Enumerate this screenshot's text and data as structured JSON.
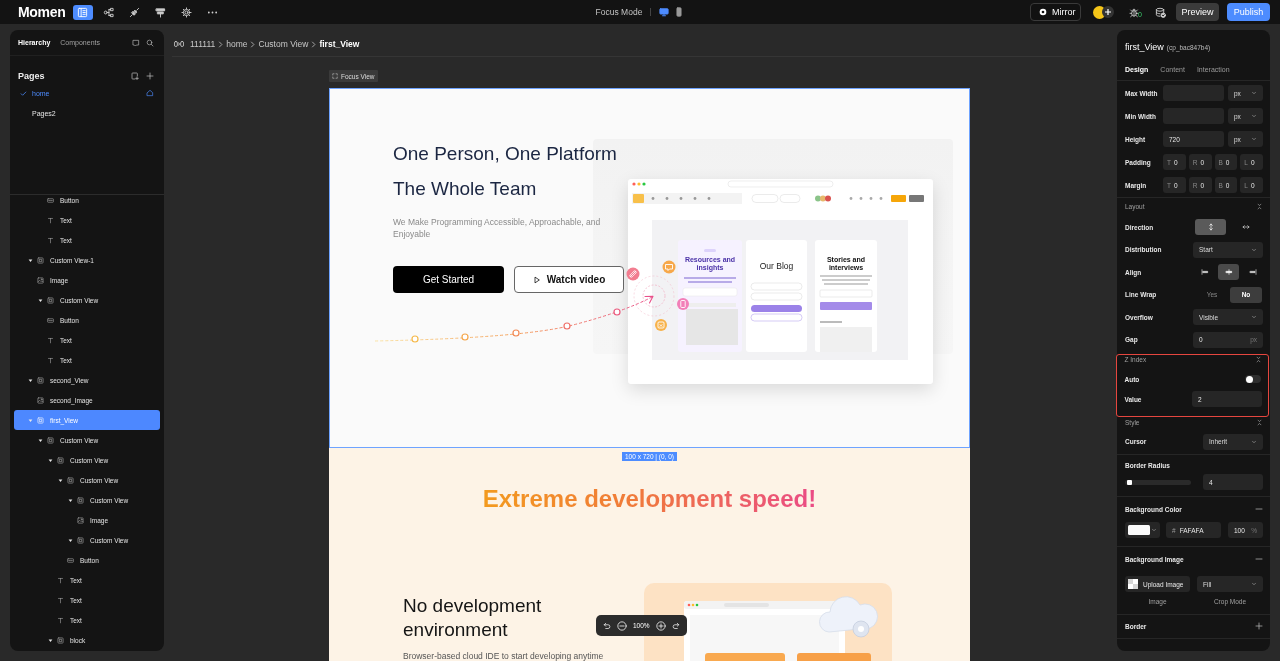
{
  "top_bar": {
    "logo": "Momen",
    "tools": [
      {
        "kind": "pages",
        "selected": true
      },
      {
        "kind": "flow",
        "selected": false
      },
      {
        "kind": "plugin",
        "selected": false
      },
      {
        "kind": "data",
        "selected": false
      },
      {
        "kind": "settings",
        "selected": false
      },
      {
        "kind": "more",
        "selected": false
      }
    ],
    "mode": "Focus Mode",
    "devices": [
      {
        "kind": "desktop",
        "selected": true
      },
      {
        "kind": "mobile",
        "selected": false
      }
    ],
    "mirror": "Mirror",
    "issues": "0",
    "preview": "Preview",
    "publish": "Publish"
  },
  "left_panel": {
    "tabs": [
      {
        "label": "Hierarchy",
        "selected": true
      },
      {
        "label": "Components",
        "selected": false
      }
    ],
    "pages": {
      "title": "Pages",
      "items": [
        {
          "label": "home",
          "selected": true,
          "home": true
        },
        {
          "label": "Pages2",
          "selected": false,
          "home": false
        }
      ]
    },
    "tree": [
      {
        "children": [
          {
            "children": [
              {
                "label": "Button",
                "kind": "button",
                "selected": false
              },
              {
                "label": "Text",
                "kind": "text",
                "selected": false
              },
              {
                "label": "Text",
                "kind": "text",
                "selected": false
              }
            ]
          }
        ]
      },
      {
        "label": "Custom View-1",
        "kind": "view",
        "expanded": true,
        "selected": false,
        "children": [
          {
            "label": "Image",
            "kind": "image",
            "selected": false
          },
          {
            "label": "Custom View",
            "kind": "view",
            "expanded": true,
            "selected": false,
            "children": [
              {
                "label": "Button",
                "kind": "button",
                "selected": false
              },
              {
                "label": "Text",
                "kind": "text",
                "selected": false
              },
              {
                "label": "Text",
                "kind": "text",
                "selected": false
              }
            ]
          }
        ]
      },
      {
        "label": "second_View",
        "kind": "view",
        "expanded": true,
        "selected": false,
        "children": [
          {
            "label": "second_Image",
            "kind": "image",
            "selected": false
          }
        ]
      },
      {
        "label": "first_View",
        "kind": "view",
        "expanded": true,
        "selected": true,
        "children": [
          {
            "label": "Custom View",
            "kind": "view",
            "expanded": true,
            "selected": false,
            "children": [
              {
                "label": "Custom View",
                "kind": "view",
                "expanded": true,
                "selected": false,
                "children": [
                  {
                    "label": "Custom View",
                    "kind": "view",
                    "expanded": true,
                    "selected": false,
                    "children": [
                      {
                        "label": "Custom View",
                        "kind": "view",
                        "expanded": true,
                        "selected": false,
                        "children": [
                          {
                            "label": "Image",
                            "kind": "image",
                            "selected": false
                          }
                        ]
                      },
                      {
                        "label": "Custom View",
                        "kind": "view",
                        "expanded": true,
                        "selected": false
                      },
                      {
                        "label": "Button",
                        "kind": "button",
                        "selected": false
                      }
                    ]
                  },
                  {
                    "label": "Text",
                    "kind": "text",
                    "selected": false
                  },
                  {
                    "label": "Text",
                    "kind": "text",
                    "selected": false
                  },
                  {
                    "label": "Text",
                    "kind": "text",
                    "selected": false
                  }
                ]
              },
              {
                "label": "block",
                "kind": "view",
                "expanded": true,
                "selected": false
              }
            ]
          }
        ]
      }
    ]
  },
  "breadcrumb": [
    "111111",
    "home",
    "Custom View",
    "first_View"
  ],
  "canvas": {
    "focus_label": "Focus View",
    "size_label": "100 x 720 | (0, 0)",
    "hero": {
      "title": [
        "One Person, One Platform",
        "The Whole Team"
      ],
      "subtitle": "We Make Programming Accessible, Approachable, and Enjoyable",
      "buttons": [
        {
          "label": "Get Started",
          "kind": "primary"
        },
        {
          "label": "Watch video",
          "kind": "outline"
        }
      ],
      "mockup": {
        "cards": [
          "Resources and insights",
          "Our Blog",
          "Stories and interviews"
        ]
      }
    },
    "feature": {
      "heading": "Extreme development speed!",
      "title": "No development environment",
      "text": "Browser-based cloud IDE to start developing anytime"
    },
    "zoom": "100%"
  },
  "properties": {
    "name": "first_View",
    "id": "(cp_bac847b4)",
    "tabs": [
      {
        "label": "Design",
        "selected": true
      },
      {
        "label": "Content",
        "selected": false
      },
      {
        "label": "Interaction",
        "selected": false
      }
    ],
    "size": [
      {
        "label": "Max Width",
        "unit": "px"
      },
      {
        "label": "Min Width",
        "unit": "px"
      },
      {
        "label": "Height",
        "value": "720",
        "unit": "px"
      }
    ],
    "spacing": [
      {
        "label": "Padding",
        "sides": [
          {
            "side": "T",
            "value": "0"
          },
          {
            "side": "R",
            "value": "0"
          },
          {
            "side": "B",
            "value": "0"
          },
          {
            "side": "L",
            "value": "0"
          }
        ]
      },
      {
        "label": "Margin",
        "sides": [
          {
            "side": "T",
            "value": "0"
          },
          {
            "side": "R",
            "value": "0"
          },
          {
            "side": "B",
            "value": "0"
          },
          {
            "side": "L",
            "value": "0"
          }
        ]
      }
    ],
    "layout": {
      "title": "Layout",
      "expanded": true,
      "direction": {
        "label": "Direction",
        "options": [
          {
            "kind": "vertical",
            "selected": true
          },
          {
            "kind": "horizontal",
            "selected": false
          }
        ]
      },
      "distribution": {
        "label": "Distribution",
        "value": "Start"
      },
      "align": {
        "label": "Align",
        "options": [
          {
            "kind": "start",
            "selected": false
          },
          {
            "kind": "center",
            "selected": true
          },
          {
            "kind": "end",
            "selected": false
          }
        ]
      },
      "wrap": {
        "label": "Line Wrap",
        "options": [
          {
            "label": "Yes",
            "selected": false
          },
          {
            "label": "No",
            "selected": true
          }
        ]
      },
      "overflow": {
        "label": "Overflow",
        "value": "Visible"
      },
      "gap": {
        "label": "Gap",
        "value": "0",
        "unit": "px"
      }
    },
    "z_index": {
      "title": "Z Index",
      "expanded": true,
      "highlighted": true,
      "auto": {
        "label": "Auto",
        "on": false
      },
      "value": {
        "label": "Value",
        "value": "2"
      }
    },
    "style": {
      "title": "Style",
      "expanded": true,
      "cursor": {
        "label": "Cursor",
        "value": "Inherit"
      }
    },
    "radius": {
      "label": "Border Radius",
      "level": 0.04,
      "value": "4"
    },
    "background_color": {
      "label": "Background Color",
      "enabled": true,
      "prefix": "#",
      "value": "FAFAFA",
      "opacity": "100",
      "unit": "%"
    },
    "background_image": {
      "label": "Background Image",
      "enabled": true,
      "upload": "Upload Image",
      "mode": "Fill",
      "captions": [
        "Image",
        "Crop Mode"
      ]
    },
    "border": {
      "label": "Border",
      "enabled": false
    }
  }
}
